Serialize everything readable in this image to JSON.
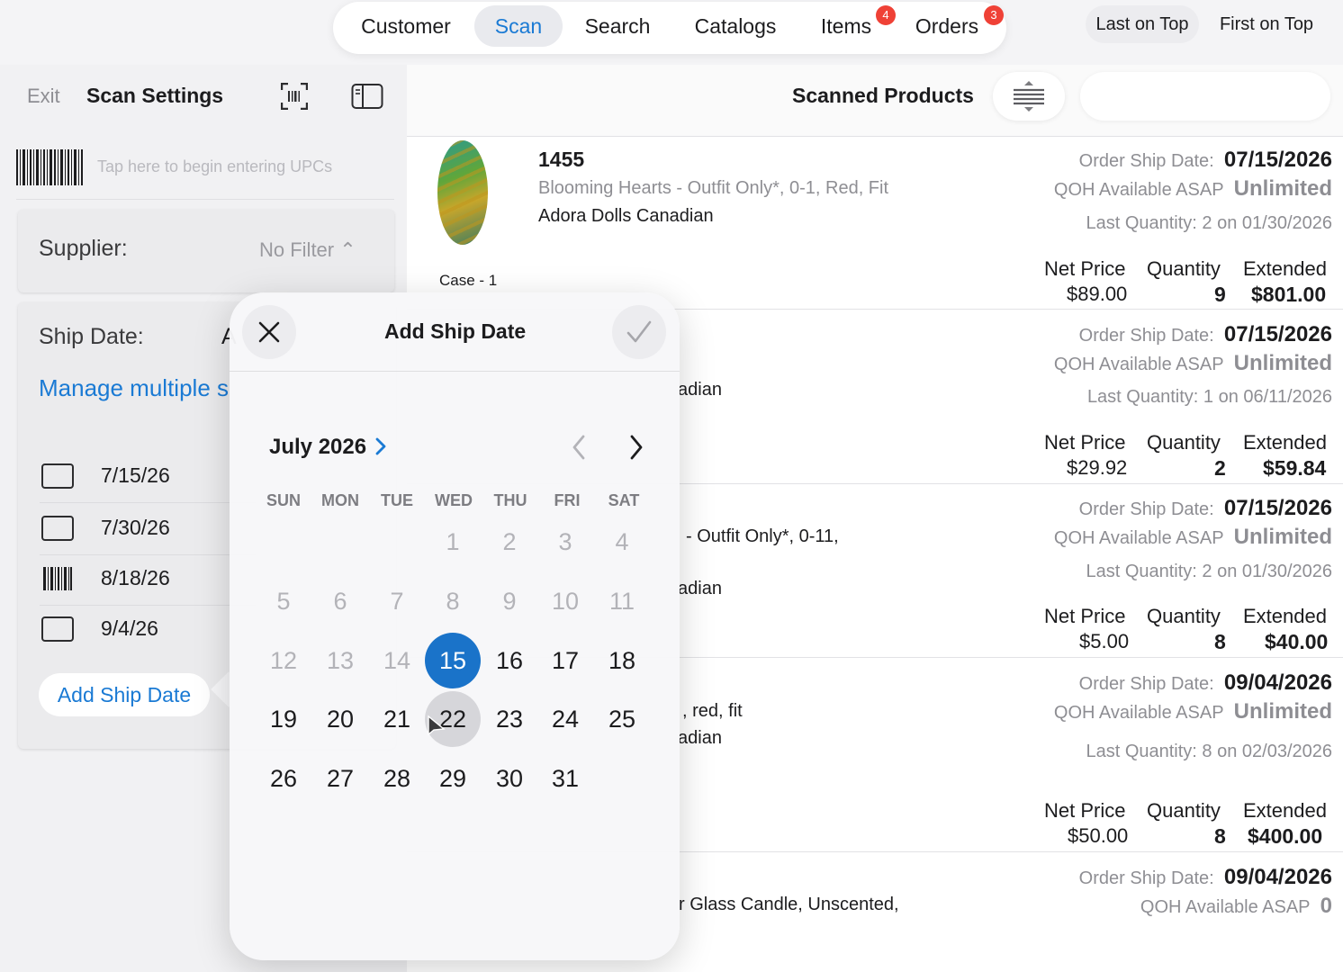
{
  "tabs": [
    {
      "label": "Customer"
    },
    {
      "label": "Scan"
    },
    {
      "label": "Search"
    },
    {
      "label": "Catalogs"
    },
    {
      "label": "Items",
      "badge": "4"
    },
    {
      "label": "Orders",
      "badge": "3"
    }
  ],
  "active_tab": "Scan",
  "left_header": {
    "exit": "Exit",
    "title": "Scan Settings"
  },
  "right_header": {
    "title": "Scanned Products",
    "sort_options": [
      "Last on Top",
      "First on Top"
    ],
    "sort_selected": "Last on Top"
  },
  "upc": {
    "placeholder": "Tap here to begin entering UPCs"
  },
  "supplier": {
    "label": "Supplier:",
    "value": "No Filter ⌃"
  },
  "ship_date": {
    "label": "Ship Date:",
    "label_cut": "A",
    "manage_link": "Manage multiple s",
    "dates": [
      "7/15/26",
      "7/30/26",
      "8/18/26",
      "9/4/26"
    ],
    "add_button": "Add Ship Date"
  },
  "popover": {
    "title": "Add Ship Date",
    "month": "July 2026",
    "weekdays": [
      "SUN",
      "MON",
      "TUE",
      "WED",
      "THU",
      "FRI",
      "SAT"
    ],
    "selected_day": "15",
    "hover_day": "22",
    "weeks": [
      [
        "",
        "",
        "",
        "1",
        "2",
        "3",
        "4"
      ],
      [
        "5",
        "6",
        "7",
        "8",
        "9",
        "10",
        "11"
      ],
      [
        "12",
        "13",
        "14",
        "15",
        "16",
        "17",
        "18"
      ],
      [
        "19",
        "20",
        "21",
        "22",
        "23",
        "24",
        "25"
      ],
      [
        "26",
        "27",
        "28",
        "29",
        "30",
        "31",
        ""
      ]
    ]
  },
  "products": [
    {
      "sku": "1455",
      "desc": "Blooming Hearts - Outfit Only*, 0-1, Red, Fit",
      "supplier": "Adora Dolls Canadian",
      "case": "Case - 1",
      "order_ship_label": "Order Ship Date:",
      "order_ship": "07/15/2026",
      "qoh_label": "QOH Available ASAP",
      "qoh": "Unlimited",
      "last_qty": "Last Quantity: 2 on 01/30/2026",
      "net_label": "Net Price",
      "qty_label": "Quantity",
      "ext_label": "Extended",
      "net": "$89.00",
      "qty": "9",
      "ext": "$801.00"
    },
    {
      "desc_partial": "adian",
      "order_ship_label": "Order Ship Date:",
      "order_ship": "07/15/2026",
      "qoh_label": "QOH Available ASAP",
      "qoh": "Unlimited",
      "last_qty": "Last Quantity: 1 on 06/11/2026",
      "net_label": "Net Price",
      "qty_label": "Quantity",
      "ext_label": "Extended",
      "net": "$29.92",
      "qty": "2",
      "ext": "$59.84"
    },
    {
      "desc_partial": "- Outfit Only*, 0-11,",
      "supplier_partial": "adian",
      "order_ship_label": "Order Ship Date:",
      "order_ship": "07/15/2026",
      "qoh_label": "QOH Available ASAP",
      "qoh": "Unlimited",
      "last_qty": "Last Quantity: 2 on 01/30/2026",
      "net_label": "Net Price",
      "qty_label": "Quantity",
      "ext_label": "Extended",
      "net": "$5.00",
      "qty": "8",
      "ext": "$40.00"
    },
    {
      "desc_partial": ", red, fit",
      "supplier_partial": "adian",
      "order_ship_label": "Order Ship Date:",
      "order_ship": "09/04/2026",
      "qoh_label": "QOH Available ASAP",
      "qoh": "Unlimited",
      "last_qty": "Last Quantity: 8 on 02/03/2026",
      "net_label": "Net Price",
      "qty_label": "Quantity",
      "ext_label": "Extended",
      "net": "$50.00",
      "qty": "8",
      "ext": "$400.00"
    },
    {
      "desc_partial": "r Glass Candle, Unscented,",
      "order_ship_label": "Order Ship Date:",
      "order_ship": "09/04/2026",
      "qoh_label": "QOH Available ASAP",
      "qoh": "0"
    }
  ],
  "colors": {
    "accent": "#1a7ad4",
    "badge": "#ef4136",
    "selected_day": "#1a73c9"
  }
}
